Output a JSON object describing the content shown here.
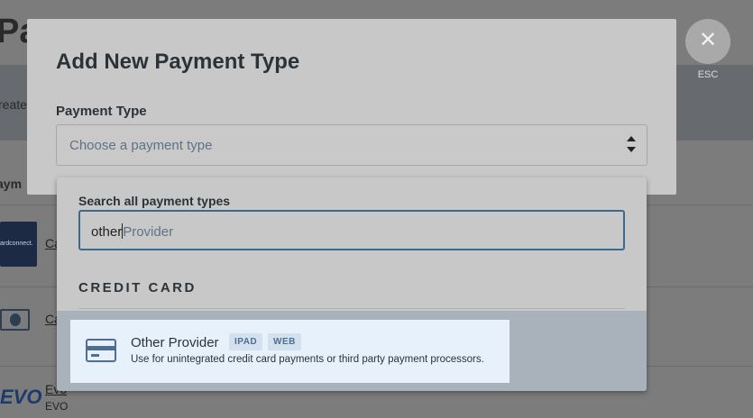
{
  "background": {
    "page_title_fragment": "Pa",
    "create_fragment": "reate",
    "section_fragment": "aym",
    "cardconnect_logo_text": "ardconnect.",
    "row_link_1": "Ca",
    "row_link_2": "Ca",
    "evo_logo_text": "EVO",
    "row_link_3": "Evo",
    "row_sub_3": "EVO"
  },
  "close": {
    "icon": "close-icon",
    "glyph": "✕",
    "label": "ESC"
  },
  "modal": {
    "title": "Add New Payment Type",
    "field_label": "Payment Type",
    "select_placeholder": "Choose a payment type"
  },
  "dropdown": {
    "search_label": "Search all payment types",
    "search_value": "other",
    "search_suggestion": "Provider",
    "group_header": "CREDIT CARD",
    "options": [
      {
        "icon": "credit-card-icon",
        "name": "Other Provider",
        "badges": [
          "IPAD",
          "WEB"
        ],
        "description": "Use for unintegrated credit card payments or third party payment processors."
      }
    ]
  },
  "colors": {
    "accent": "#3b6a8f",
    "highlight": "#e6f1fc",
    "badge_bg": "#d3e1ee",
    "badge_text": "#4f6f92"
  }
}
